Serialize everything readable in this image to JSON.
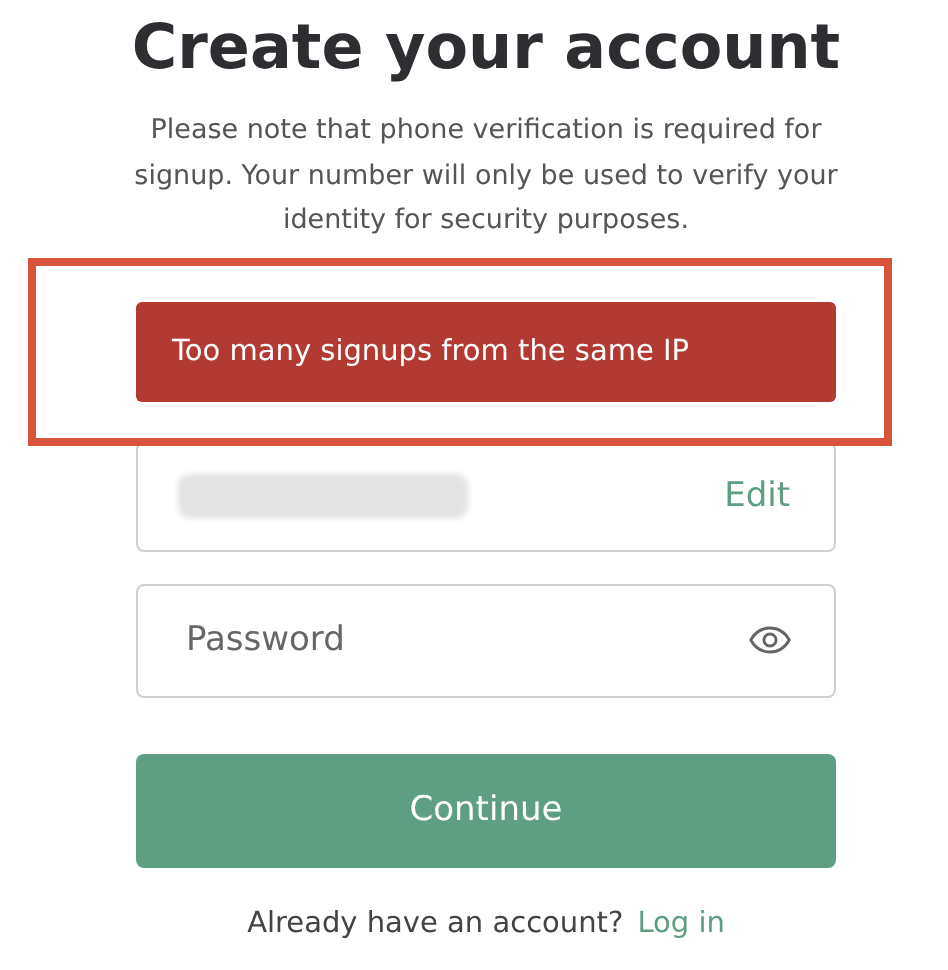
{
  "title": "Create your account",
  "note": "Please note that phone verification is required for signup. Your number will only be used to verify your identity for security purposes.",
  "error": {
    "message": "Too many signups from the same IP",
    "highlighted": true
  },
  "email_field": {
    "redacted": true,
    "action": "Edit"
  },
  "password_field": {
    "placeholder": "Password"
  },
  "continue_button": "Continue",
  "footer": {
    "text": "Already have an account?",
    "link": "Log in"
  }
}
